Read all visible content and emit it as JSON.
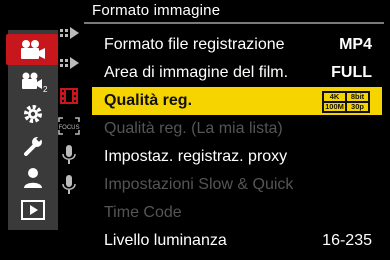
{
  "header": {
    "title": "Formato immagine"
  },
  "left_tabs": [
    {
      "name": "video-camera-icon",
      "active": true
    },
    {
      "name": "video-camera-2-icon",
      "active": false
    },
    {
      "name": "gear-icon",
      "active": false
    },
    {
      "name": "wrench-icon",
      "active": false
    },
    {
      "name": "person-icon",
      "active": false
    },
    {
      "name": "playback-icon",
      "active": false
    }
  ],
  "sub_tabs": [
    {
      "name": "page-1-icon"
    },
    {
      "name": "page-2-icon"
    },
    {
      "name": "film-icon"
    },
    {
      "name": "focus-icon",
      "label": "FOCUS"
    },
    {
      "name": "microphone-icon"
    },
    {
      "name": "microphone-2-icon"
    }
  ],
  "menu": {
    "items": [
      {
        "label": "Formato file registrazione",
        "value": "MP4",
        "state": "normal"
      },
      {
        "label": "Area di immagine del film.",
        "value": "FULL",
        "state": "normal"
      },
      {
        "label": "Qualità reg.",
        "value": "",
        "state": "selected",
        "badge": [
          "4K",
          "8bit",
          "100M",
          "30p"
        ]
      },
      {
        "label": "Qualità reg. (La mia lista)",
        "value": "",
        "state": "disabled"
      },
      {
        "label": "Impostaz. registraz. proxy",
        "value": "",
        "state": "normal"
      },
      {
        "label": "Impostazioni Slow & Quick",
        "value": "",
        "state": "disabled"
      },
      {
        "label": "Time Code",
        "value": "",
        "state": "disabled"
      },
      {
        "label": "Livello luminanza",
        "value": "16-235",
        "state": "bold"
      }
    ]
  },
  "colors": {
    "active_tab": "#c8161d",
    "highlight": "#f5d400",
    "panel": "#3a3a3a"
  }
}
